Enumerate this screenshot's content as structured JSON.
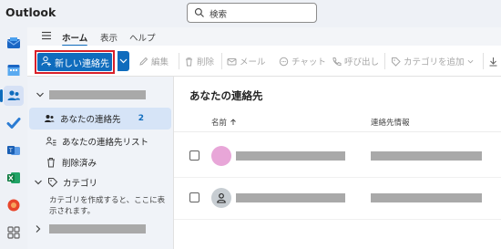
{
  "app": {
    "title": "Outlook"
  },
  "search": {
    "placeholder": "検索"
  },
  "ribbon": {
    "tabs": [
      {
        "label": "ホーム",
        "active": true
      },
      {
        "label": "表示",
        "active": false
      },
      {
        "label": "ヘルプ",
        "active": false
      }
    ]
  },
  "toolbar": {
    "new_contact": "新しい連絡先",
    "edit": "編集",
    "delete": "削除",
    "mail": "メール",
    "chat": "チャット",
    "call": "呼び出し",
    "add_category": "カテゴリを追加"
  },
  "folders": {
    "items": [
      {
        "label": "あなたの連絡先",
        "count": "2",
        "selected": true
      },
      {
        "label": "あなたの連絡先リスト"
      },
      {
        "label": "削除済み"
      }
    ],
    "categories_label": "カテゴリ",
    "categories_hint": "カテゴリを作成すると、ここに表示されます。"
  },
  "main": {
    "title": "あなたの連絡先",
    "col_name": "名前",
    "col_info": "連絡先情報"
  },
  "colors": {
    "accent": "#0f6cbd",
    "highlight_border": "#d8202a",
    "selected_bg": "#d6e4f7",
    "avatar_pink": "#e8a6d8",
    "avatar_grey": "#8a9399",
    "redaction": "#a9a9a9"
  }
}
